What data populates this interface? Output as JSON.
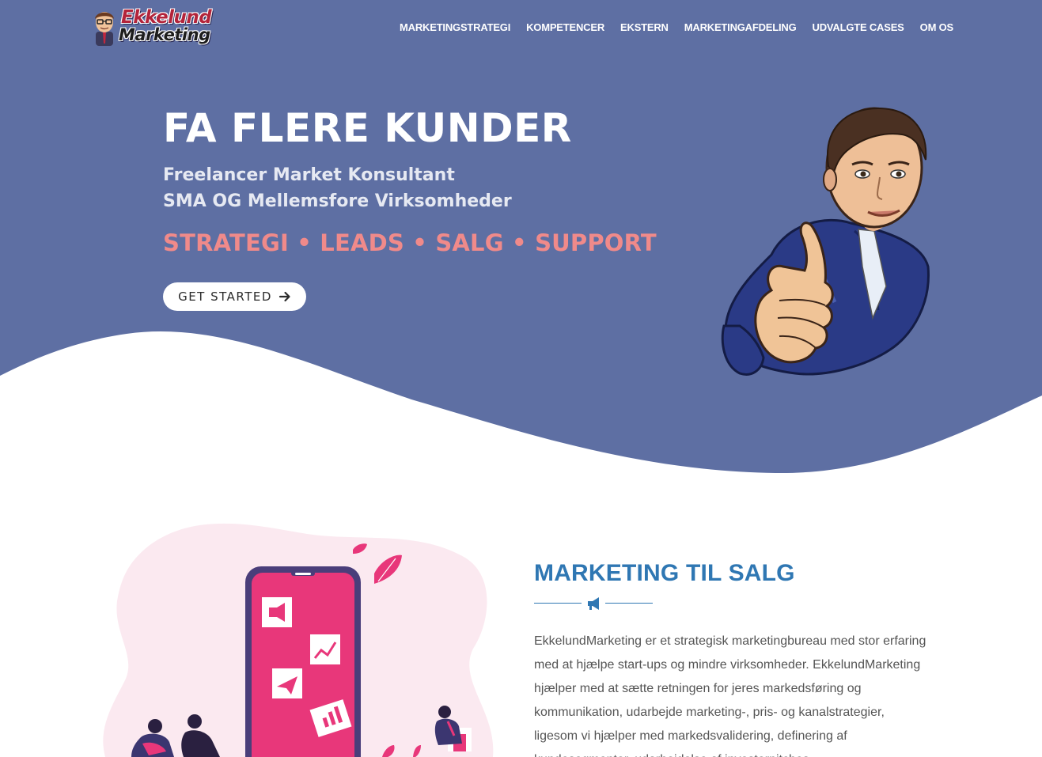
{
  "logo": {
    "line1": "Ekkelund",
    "line2": "Marketing"
  },
  "nav": {
    "items": [
      {
        "label": "MARKETINGSTRATEGI"
      },
      {
        "label": "KOMPETENCER"
      },
      {
        "label": "EKSTERN"
      },
      {
        "label": "MARKETINGAFDELING"
      },
      {
        "label": "UDVALGTE CASES"
      },
      {
        "label": "OM OS"
      }
    ]
  },
  "hero": {
    "title": "FA FLERE KUNDER",
    "subtitle_line1": "Freelancer Market Konsultant",
    "subtitle_line2": "SMA OG Mellemsfore Virksomheder",
    "tagline": "STRATEGI • LEADS • SALG • SUPPORT",
    "cta_label": "GET STARTED",
    "cta_icon": "arrow-right-icon"
  },
  "intro": {
    "title": "MARKETING TIL SALG",
    "divider_icon": "megaphone-icon",
    "paragraph": "EkkelundMarketing er et strategisk marketingbureau med stor erfaring med at hjælpe start-ups og mindre virksomheder. EkkelundMarketing hjælper med at sætte retningen for jeres markedsføring og kommunikation, udarbejde marketing-, pris- og kanalstrategier, ligesom vi hjælper med markedsvalidering, definering af kundesegmenter, udarbejdelse af investorpitches"
  },
  "colors": {
    "hero_bg": "#5e6fa3",
    "accent_pink": "#e8377a",
    "tagline_coral": "#f08a8a",
    "title_blue": "#2f77b3",
    "blob_pink": "#fbe9f0"
  }
}
